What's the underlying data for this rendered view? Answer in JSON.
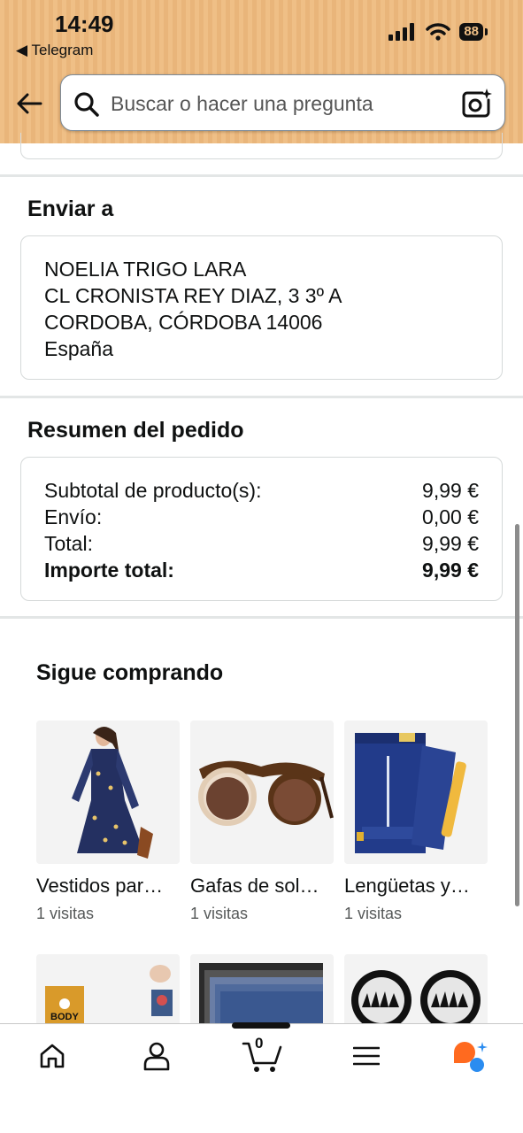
{
  "status_bar": {
    "time": "14:49",
    "back_app": "◀ Telegram",
    "battery": "88"
  },
  "search": {
    "placeholder": "Buscar o hacer una pregunta"
  },
  "ship_to": {
    "title": "Enviar a",
    "lines": [
      "NOELIA TRIGO LARA",
      "CL CRONISTA REY DIAZ, 3 3º A",
      "CORDOBA, CÓRDOBA 14006",
      "España"
    ]
  },
  "order_summary": {
    "title": "Resumen del pedido",
    "rows": [
      {
        "label": "Subtotal de producto(s):",
        "value": "9,99 €"
      },
      {
        "label": "Envío:",
        "value": "0,00 €"
      },
      {
        "label": "Total:",
        "value": "9,99 €"
      },
      {
        "label": "Importe total:",
        "value": "9,99 €"
      }
    ]
  },
  "keep_shopping": {
    "title": "Sigue comprando",
    "products": [
      {
        "name": "Vestidos par…",
        "visits": "1 visitas"
      },
      {
        "name": "Gafas de sol…",
        "visits": "1 visitas"
      },
      {
        "name": "Lengüetas y…",
        "visits": "1 visitas"
      }
    ],
    "second_row_badge": "BODY"
  },
  "bottom_nav": {
    "cart_count": "0",
    "items": [
      "home-icon",
      "account-icon",
      "cart-icon",
      "menu-icon",
      "rufus-assistant-icon"
    ]
  },
  "colors": {
    "header_bg": "#efbf86",
    "divider": "#e3e6e6",
    "card_border": "#d5d9d9",
    "text": "#0f1111",
    "muted": "#565959",
    "assistant_orange": "#ff6a1f",
    "assistant_blue": "#2a8cf0"
  }
}
